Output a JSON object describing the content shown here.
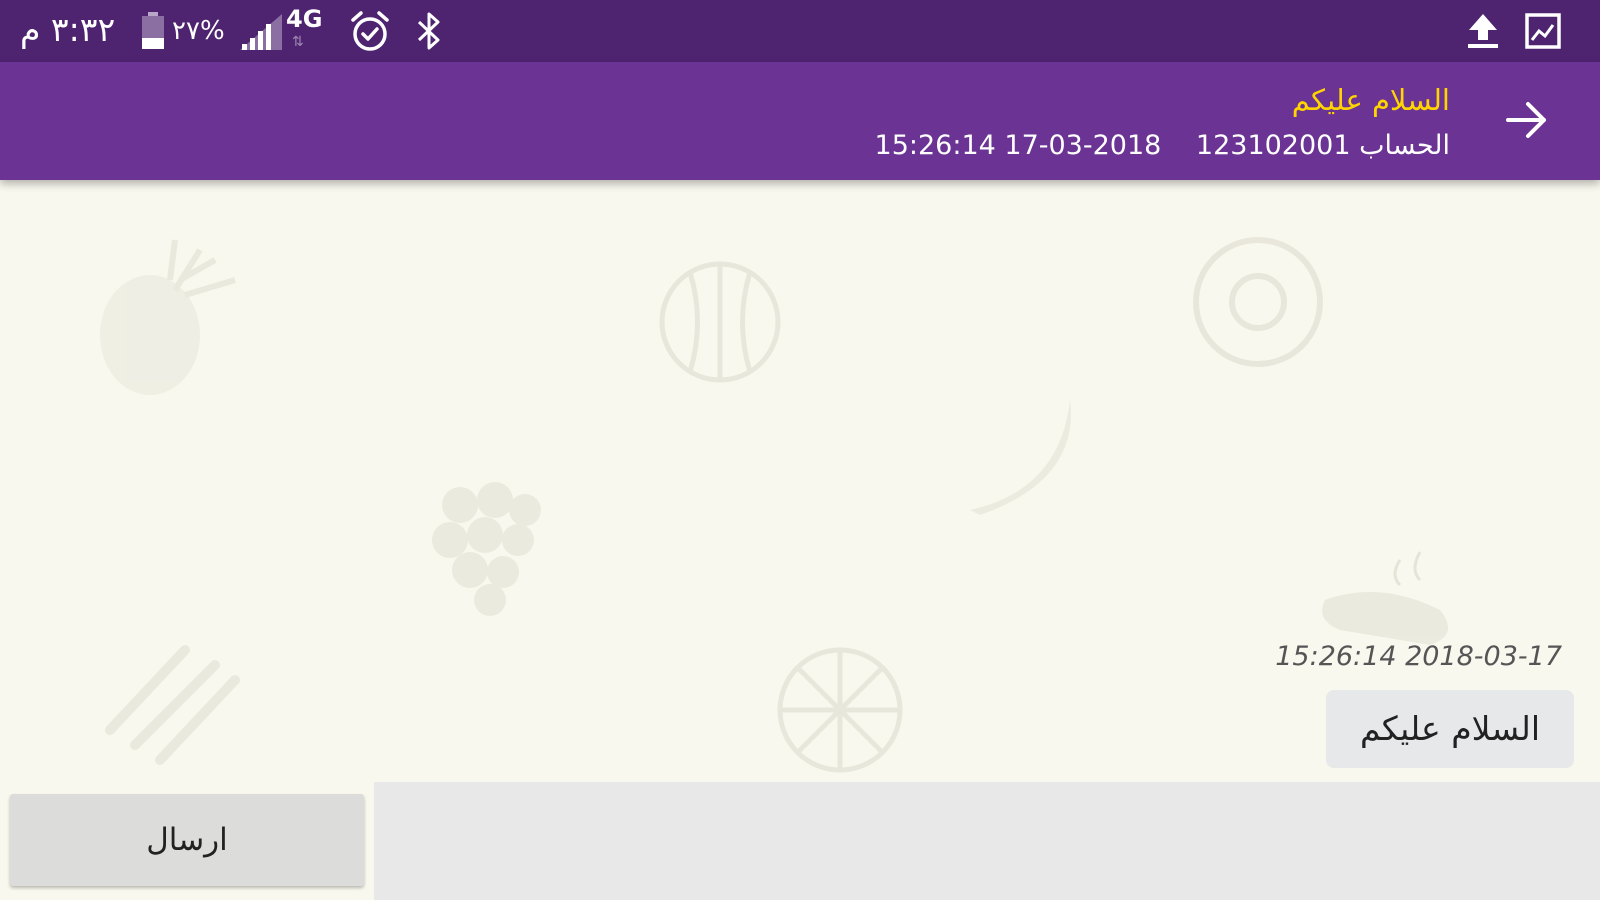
{
  "status_bar": {
    "time": "٣:٣٢ م",
    "battery_percent": "%٢٧",
    "network_type": "4G",
    "icons": [
      "battery-icon",
      "signal-icon",
      "alarm-icon",
      "bluetooth-icon",
      "upload-icon",
      "gallery-icon"
    ]
  },
  "header": {
    "title": "السلام عليكم",
    "account_label": "الحساب",
    "account_number": "123102001",
    "datetime": "15:26:14 17-03-2018",
    "back_icon": "arrow-right-icon"
  },
  "messages": [
    {
      "timestamp": "15:26:14 2018-03-17",
      "text": "السلام عليكم"
    }
  ],
  "composer": {
    "send_label": "ارسال",
    "input_value": "",
    "input_placeholder": ""
  },
  "colors": {
    "status_bar": "#4e2370",
    "app_bar": "#6b3394",
    "title": "#ffd400",
    "chat_background": "#f9f8ee",
    "bubble": "#e7e8ea"
  }
}
